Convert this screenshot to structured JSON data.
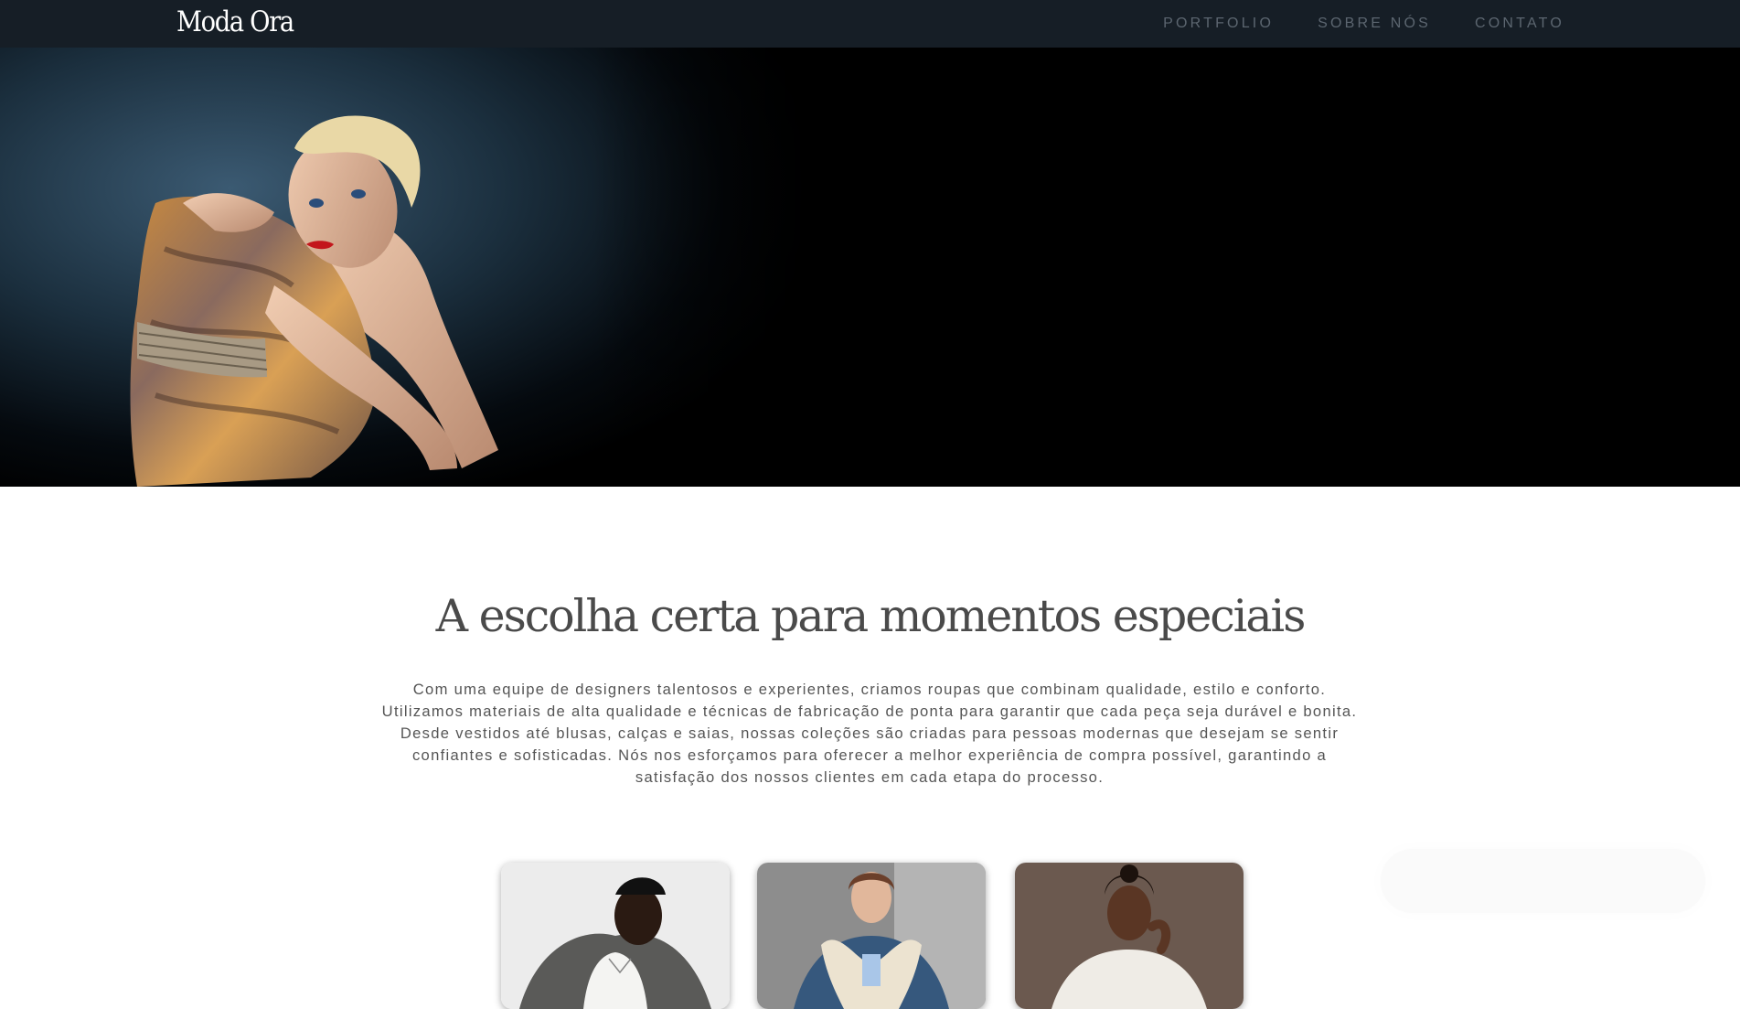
{
  "brand": "Moda Ora",
  "nav": [
    "PORTFOLIO",
    "SOBRE NÓS",
    "CONTATO"
  ],
  "hero": {
    "image_alt": "fashion-model-photo"
  },
  "intro": {
    "title": "A escolha certa para momentos especiais",
    "paragraph": "Com uma equipe de designers talentosos e experientes, criamos roupas que combinam qualidade, estilo e conforto. Utilizamos materiais de alta qualidade e técnicas de fabricação de ponta para garantir que cada peça seja durável e bonita. Desde vestidos até blusas, calças e saias, nossas coleções são criadas para pessoas modernas que desejam se sentir confiantes e sofisticadas. Nós nos esforçamos para oferecer a melhor experiência de compra possível, garantindo a satisfação dos nossos clientes em cada etapa do processo."
  },
  "cards": [
    {
      "image": "man-in-blazer-photo"
    },
    {
      "image": "woman-in-fur-jacket-photo"
    },
    {
      "image": "woman-in-white-shirt-photo"
    }
  ],
  "colors": {
    "navbar": "#161e26",
    "nav_text": "#5c6670",
    "headline": "#4a4a4a",
    "body_text": "#555555"
  }
}
